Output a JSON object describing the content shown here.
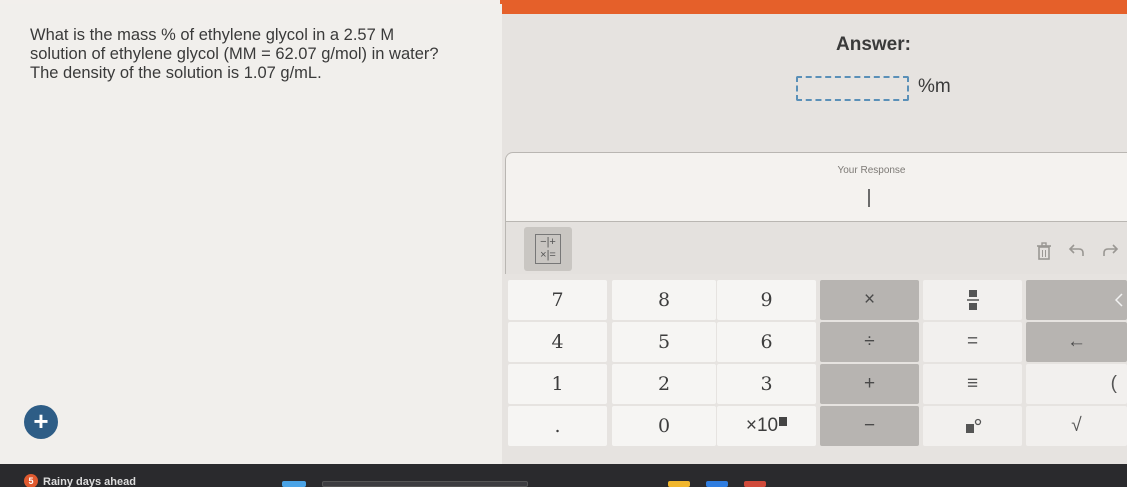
{
  "question": {
    "lines": [
      "What is the mass % of ethylene glycol in a 2.57 M",
      "solution of ethylene glycol (MM = 62.07 g/mol) in water?",
      "The density of the solution is 1.07 g/mL."
    ]
  },
  "answer": {
    "title": "Answer:",
    "value": "",
    "unit": "%m"
  },
  "response": {
    "label": "Your Response",
    "value": ""
  },
  "toolbar": {
    "mode_toggle_top": "−|+",
    "mode_toggle_bottom": "×|=",
    "delete_icon": "trash-icon",
    "undo_icon": "undo-icon",
    "redo_icon": "redo-icon"
  },
  "keypad": {
    "digits": {
      "seven": "7",
      "eight": "8",
      "nine": "9",
      "four": "4",
      "five": "5",
      "six": "6",
      "one": "1",
      "two": "2",
      "three": "3",
      "decimal": ".",
      "zero": "0",
      "times_ten": "×10"
    },
    "operators": {
      "multiply": "×",
      "divide": "÷",
      "plus": "+",
      "minus": "−",
      "fraction_icon": "fraction-icon",
      "equals": "=",
      "equiv": "≡",
      "degree_icon": "degree-icon",
      "backspace": "←",
      "left_paren": "(",
      "sqrt": "√",
      "more_icon": "chevron-left-icon"
    }
  },
  "sidebar_button": {
    "label": "+"
  },
  "taskbar": {
    "weather_badge": "5",
    "weather_text": "Rainy days ahead"
  },
  "colors": {
    "accent_orange": "#e5602a",
    "answer_box_border": "#5a90b8",
    "add_button": "#2e5d86",
    "taskbar": "#2a2a2d"
  }
}
